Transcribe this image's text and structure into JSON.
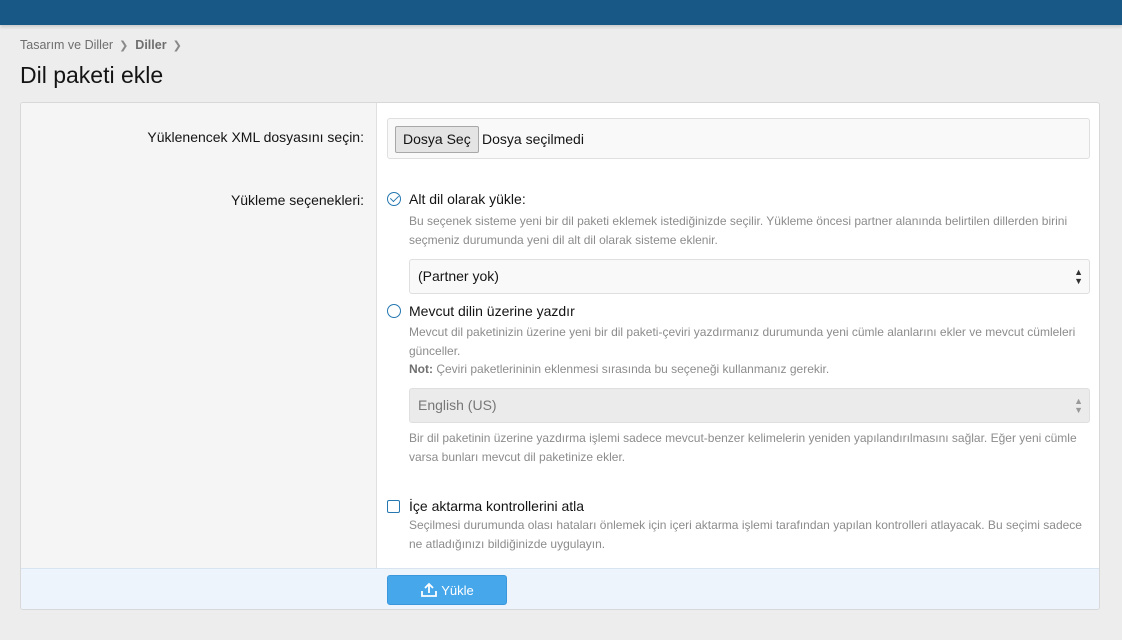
{
  "breadcrumb": [
    "Tasarım ve Diller",
    "Diller"
  ],
  "page_title": "Dil paketi ekle",
  "upload": {
    "label": "Yüklenencek XML dosyasını seçin:",
    "button": "Dosya Seç",
    "status": "Dosya seçilmedi"
  },
  "options": {
    "label": "Yükleme seçenekleri:",
    "child": {
      "label": "Alt dil olarak yükle:",
      "hint": "Bu seçenek sisteme yeni bir dil paketi eklemek istediğinizde seçilir. Yükleme öncesi partner alanında belirtilen dillerden birini seçmeniz durumunda yeni dil alt dil olarak sisteme eklenir.",
      "select_value": "(Partner yok)"
    },
    "overwrite": {
      "label": "Mevcut dilin üzerine yazdır",
      "hint": "Mevcut dil paketinizin üzerine yeni bir dil paketi-çeviri yazdırmanız durumunda yeni cümle alanlarını ekler ve mevcut cümleleri günceller.",
      "note_label": "Not:",
      "note_text": "Çeviri paketlerininin eklenmesi sırasında bu seçeneği kullanmanız gerekir.",
      "select_value": "English (US)",
      "hint2": "Bir dil paketinin üzerine yazdırma işlemi sadece mevcut-benzer kelimelerin yeniden yapılandırılmasını sağlar. Eğer yeni cümle varsa bunları mevcut dil paketinize ekler."
    },
    "skip_checks": {
      "label": "İçe aktarma kontrollerini atla",
      "hint": "Seçilmesi durumunda olası hataları önlemek için içeri aktarma işlemi tarafından yapılan kontrolleri atlayacak. Bu seçimi sadece ne atladığınızı bildiğinizde uygulayın."
    }
  },
  "submit_label": "Yükle",
  "colors": {
    "topbar": "#185886",
    "accent": "#2577b1",
    "button": "#47a7eb"
  }
}
